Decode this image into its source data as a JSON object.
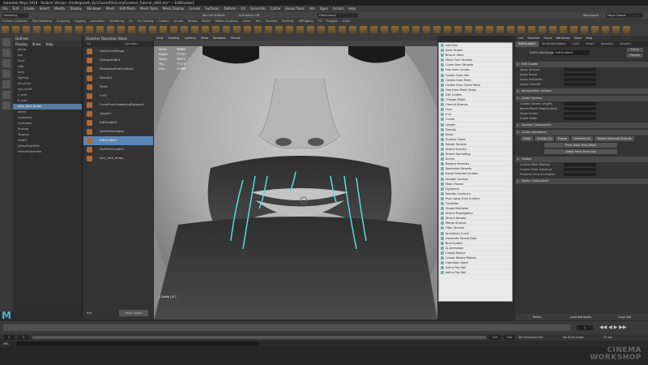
{
  "window_title": "Autodesk Maya 2018 - Student Version: /Undergrowth_Ep1/GuardFile/LarryFaceHair_Tutorial_v002.ma* --- EditGuides2",
  "menus": [
    "File",
    "Edit",
    "Create",
    "Select",
    "Modify",
    "Display",
    "Windows",
    "Mesh",
    "Edit Mesh",
    "Mesh Tools",
    "Mesh Display",
    "Curves",
    "Surfaces",
    "Deform",
    "UV",
    "Generate",
    "Cache",
    "Bonus Tools",
    "Yeti",
    "Xgen",
    "Arnold",
    "Help"
  ],
  "status_line": {
    "workspace_mode": "Modeling",
    "live_surface": "No Live Surface",
    "symmetry": "Symmetry: Off",
    "selected_node": "EditGuides2",
    "workspace_label": "Workspace",
    "workspace_value": "Maya Classic"
  },
  "shelf_tabs": [
    "Curves / Surfaces",
    "Poly Modeling",
    "Sculpting",
    "Rigging",
    "Animation",
    "Rendering",
    "FX",
    "FX Caching",
    "Custom",
    "Arnold",
    "Bifrost",
    "MASH",
    "Motion Graphics",
    "XGen",
    "Yeti",
    "Tooshed",
    "Redshift",
    "HBRigging",
    "FX",
    "Pugglen",
    "XGen"
  ],
  "outliner": {
    "title": "Outliner",
    "menu": [
      "Display",
      "Show",
      "Help"
    ],
    "rows": [
      "persp",
      "top",
      "front",
      "side",
      "larry",
      "lighting",
      "larryCam",
      "eye_mesh",
      "L_eyel",
      "R_eyel",
      "larry_face_brows",
      "beard",
      "mustache",
      "eyebrows",
      "dusting",
      "Tongue1",
      "Tooth1",
      "defaultLightSet",
      "defaultObjectSet"
    ],
    "selected_index": 10
  },
  "op_stack": {
    "title": "Groomer Operation Stack",
    "col_left": "Op",
    "col_right": "Operation",
    "items": [
      "HashCurveShape",
      "ChangeWidth1",
      "PushAwayFromSurface1",
      "Density1",
      "Frizz1",
      "Curl1",
      "CurveFromGuidesAndDistance1",
      "Length1",
      "EditGuides2",
      "HairFromGuides2",
      "EditGuides2",
      "HairFromGuides3",
      "larry_face_brows"
    ],
    "selected_index": 10,
    "footer_left": "fine",
    "footer_right": "Save Groom"
  },
  "viewport": {
    "menus": [
      "View",
      "Shading",
      "Lighting",
      "Show",
      "Renderer",
      "Panels"
    ],
    "hud": [
      {
        "label": "Verts:",
        "value": "39983"
      },
      {
        "label": "Edges:",
        "value": "77797"
      },
      {
        "label": "Faces:",
        "value": "38874"
      },
      {
        "label": "Tris:",
        "value": "77274"
      },
      {
        "label": "UVs:",
        "value": "47980"
      }
    ],
    "camera_label": "persp",
    "bottom_label": "[ Comb ] 8.7"
  },
  "context_menu": {
    "items": [
      "Add Hair",
      "Save Groom",
      "Branch Hairs",
      "Mesh from Strands",
      "Curve from Strands",
      "Hair from Guides",
      "Guides from Hair",
      "Guides from Mesh",
      "Guides from Guide Mesh",
      "Hair from Mesh Strips",
      "Edit Guides",
      "Change Width",
      "Ground Strands",
      "Frizz",
      "Curl",
      "Clump",
      "Length",
      "Density",
      "Noise",
      "Surface Comb",
      "Rotate Strands",
      "Strand Gravity",
      "Strand Spreading",
      "Sculpt",
      "Resolve Normals",
      "Normalize Strands",
      "Adopt Selected Guides",
      "Smooth Surface",
      "Mean Planes",
      "Dynamics",
      "Reorder Contours",
      "Push Away from Surface",
      "Oscillator",
      "Shape Multiplier",
      "Strand Propagation",
      "Strand Iterator",
      "Merge Strands",
      "Filter Strands",
      "Animation Curve",
      "Generate Strand Data",
      "Bind Guides",
      "AI Animation",
      "Create Weave",
      "Create Weave Pattern",
      "Operation Stack",
      "Add a Flip Hair",
      "Add a Flip Hair"
    ]
  },
  "attribute_editor": {
    "menus": [
      "List",
      "Selected",
      "Focus",
      "Attributes",
      "Show",
      "Help"
    ],
    "tabs": [
      "EditGuides2",
      "larryEditGuides2",
      "Curl1",
      "Frizz1",
      "Density1",
      "Length1"
    ],
    "active_tab": 0,
    "node_type_label": "EditGuidesShape:",
    "node_type_value": "EditGuides2",
    "focus": "Focus",
    "presets": "Presets",
    "show": "Show",
    "hide": "Hide",
    "sections": [
      {
        "title": "Edit Guides",
        "fields": [
          "Apply Amount",
          "Apply Ramp"
        ]
      },
      {
        "title": "",
        "fields": [
          "Apply Multiplier",
          "Apply Channel"
        ]
      },
      {
        "title": "Interpolation Options",
        "fields": []
      },
      {
        "title": "Guide Options",
        "fields": [
          "Guided Strand Lengths",
          "Ignore Bend Shaping Keys",
          "Show Guides",
          "Guide Width"
        ]
      },
      {
        "title": "Applied Components",
        "fields": []
      },
      {
        "title": "Guide Operations",
        "fields": []
      },
      {
        "title": "Guides",
        "fields": [
          "Control Point Position",
          "Control Point Influence",
          "Preserve Strand Lengths"
        ]
      },
      {
        "title": "Notes: EditGuides2",
        "fields": []
      }
    ],
    "apply_channel_value": "None",
    "ops_buttons": [
      "Hook",
      "Unhide All",
      "Freeze",
      "Unfreeze All",
      "Delete Selected Strands"
    ],
    "ops_buttons2": [
      "Push Away from Mesh",
      "Adopt from Stack Top"
    ],
    "footer": [
      "Select",
      "Load Attributes",
      "Copy Tab"
    ]
  },
  "timeline": {
    "start": "1",
    "end": "120",
    "current": "1",
    "ticks": [
      "5",
      "10",
      "15",
      "20",
      "25",
      "30",
      "35",
      "40",
      "45",
      "50",
      "55",
      "60",
      "65",
      "70",
      "75",
      "80",
      "85",
      "90",
      "95",
      "100",
      "105",
      "110",
      "115",
      "120"
    ]
  },
  "range": {
    "min": "1",
    "max": "120",
    "anim_end": "200",
    "no_char_set": "No Character Set",
    "no_anim_layer": "No Anim Layer",
    "fps": "24 fps"
  },
  "cmdline": {
    "label": "MEL"
  },
  "watermark": {
    "line1": "CINEMA",
    "line2": "WORKSHOP"
  }
}
